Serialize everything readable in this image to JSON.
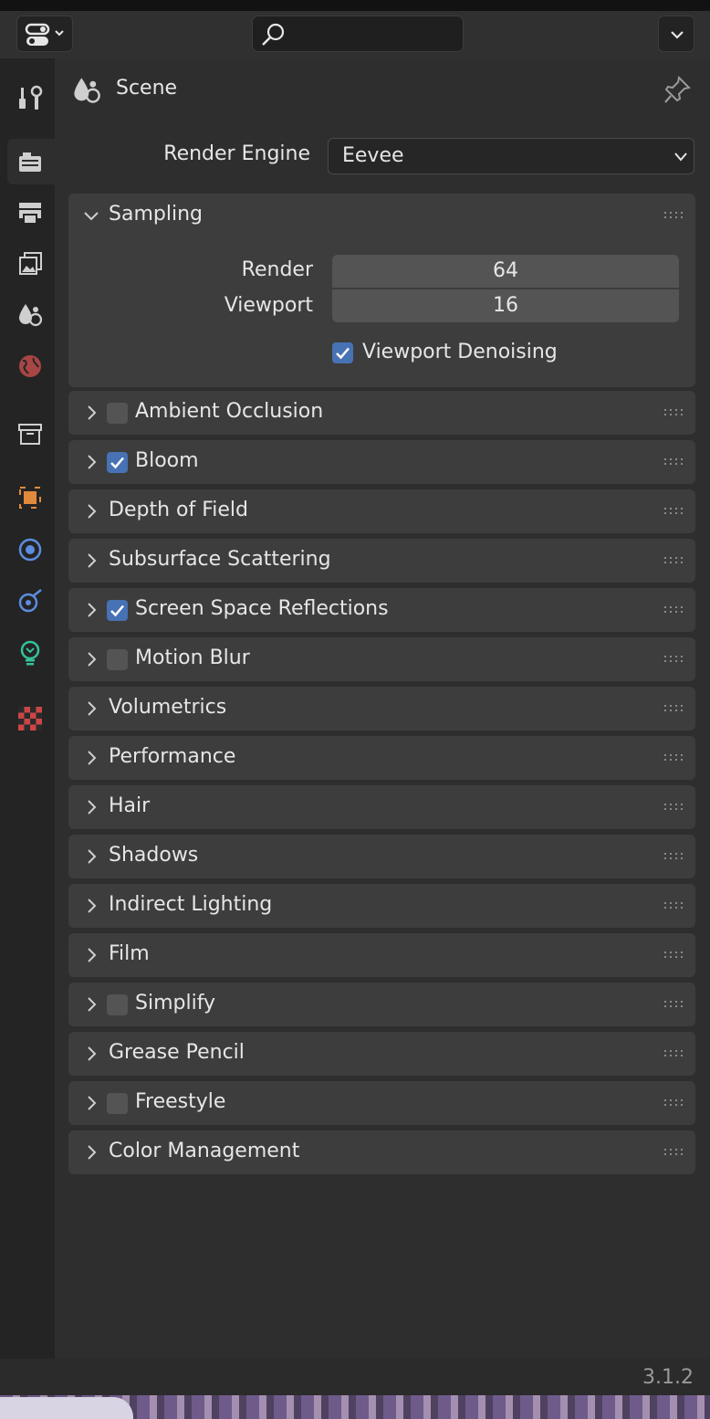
{
  "header": {
    "search_placeholder": "",
    "editor_type_icon": "properties-editor-icon",
    "options_icon": "chevron-down-icon"
  },
  "tabs": [
    {
      "name": "tool",
      "icon": "wrench-screwdriver-icon"
    },
    {
      "name": "render",
      "icon": "render-camera-icon",
      "active": true
    },
    {
      "name": "output",
      "icon": "printer-icon"
    },
    {
      "name": "view-layer",
      "icon": "image-stack-icon"
    },
    {
      "name": "scene",
      "icon": "scene-drops-icon"
    },
    {
      "name": "world",
      "icon": "world-globe-icon"
    },
    {
      "name": "collection",
      "icon": "collection-box-icon"
    },
    {
      "name": "object",
      "icon": "object-square-icon"
    },
    {
      "name": "modifiers",
      "icon": "physics-circle-icon"
    },
    {
      "name": "constraints",
      "icon": "constraint-icon"
    },
    {
      "name": "data",
      "icon": "light-bulb-icon"
    },
    {
      "name": "texture",
      "icon": "checkerboard-icon"
    }
  ],
  "context": {
    "label": "Scene"
  },
  "render_engine": {
    "label": "Render Engine",
    "value": "Eevee"
  },
  "sampling": {
    "title": "Sampling",
    "render_label": "Render",
    "render_value": "64",
    "viewport_label": "Viewport",
    "viewport_value": "16",
    "denoise_label": "Viewport Denoising"
  },
  "panels": [
    {
      "title": "Ambient Occlusion",
      "checkbox": true,
      "checked": false
    },
    {
      "title": "Bloom",
      "checkbox": true,
      "checked": true
    },
    {
      "title": "Depth of Field",
      "checkbox": false
    },
    {
      "title": "Subsurface Scattering",
      "checkbox": false
    },
    {
      "title": "Screen Space Reflections",
      "checkbox": true,
      "checked": true
    },
    {
      "title": "Motion Blur",
      "checkbox": true,
      "checked": false
    },
    {
      "title": "Volumetrics",
      "checkbox": false
    },
    {
      "title": "Performance",
      "checkbox": false
    },
    {
      "title": "Hair",
      "checkbox": false
    },
    {
      "title": "Shadows",
      "checkbox": false
    },
    {
      "title": "Indirect Lighting",
      "checkbox": false
    },
    {
      "title": "Film",
      "checkbox": false
    },
    {
      "title": "Simplify",
      "checkbox": true,
      "checked": false
    },
    {
      "title": "Grease Pencil",
      "checkbox": false
    },
    {
      "title": "Freestyle",
      "checkbox": true,
      "checked": false
    },
    {
      "title": "Color Management",
      "checkbox": false
    }
  ],
  "status": {
    "version": "3.1.2"
  },
  "colors": {
    "accent": "#4772b3",
    "panel": "#3d3d3d",
    "field": "#545454"
  }
}
